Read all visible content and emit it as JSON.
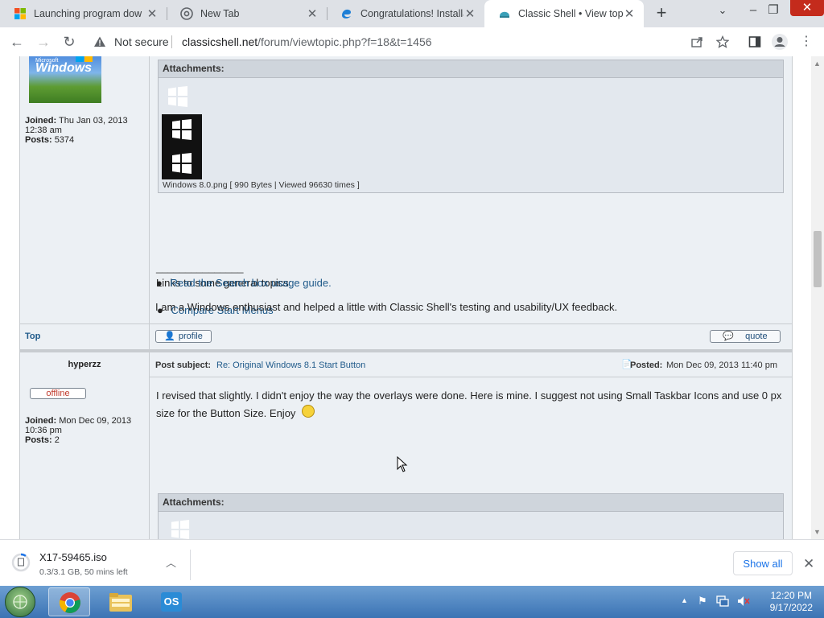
{
  "browser": {
    "tabs": [
      {
        "title": "Launching program dow",
        "active": false
      },
      {
        "title": "New Tab",
        "active": false
      },
      {
        "title": "Congratulations! Installat",
        "active": false
      },
      {
        "title": "Classic Shell • View topic",
        "active": true
      }
    ],
    "security_label": "Not secure",
    "url_host": "classicshell.net",
    "url_path": "/forum/viewtopic.php?f=18&t=1456"
  },
  "post1": {
    "avatar_text": "Windows",
    "avatar_subtext": "Microsoft",
    "joined_label": "Joined:",
    "joined_value": "Thu Jan 03, 2013 12:38 am",
    "posts_label": "Posts:",
    "posts_value": "5374",
    "attachments_label": "Attachments:",
    "attachment_file": "Windows 8.0.png [ 990 Bytes | Viewed 96630 times ]",
    "signature_rule": "_______________",
    "links_intro": "Links to some general topics:",
    "link_1": "Compare Start Menus",
    "link_2": "Read the Search box usage guide.",
    "sig_text": "I am a Windows enthusiast and helped a little with Classic Shell's testing and usability/UX feedback.",
    "top_link": "Top",
    "profile_btn": "profile",
    "quote_btn": "quote"
  },
  "post2": {
    "author": "hyperzz",
    "status": "offline",
    "joined_label": "Joined:",
    "joined_value": "Mon Dec 09, 2013 10:36 pm",
    "posts_label": "Posts:",
    "posts_value": "2",
    "subject_label": "Post subject:",
    "subject": "Re: Original Windows 8.1 Start Button",
    "posted_label": "Posted:",
    "posted_value": "Mon Dec 09, 2013 11:40 pm",
    "body": "I revised that slightly. I didn't enjoy the way the overlays were done. Here is mine. I suggest not using Small Taskbar Icons and use 0 px size for the Button Size. Enjoy",
    "attachments_label": "Attachments:"
  },
  "download": {
    "filename": "X17-59465.iso",
    "status": "0.3/3.1 GB, 50 mins left",
    "show_all": "Show all"
  },
  "taskbar": {
    "time": "12:20 PM",
    "date": "9/17/2022",
    "app_label": "OS"
  },
  "colors": {
    "forum_bg": "#ecf0f4",
    "link": "#1f5a8a",
    "chrome_accent": "#1a73e8",
    "offline_badge": "#c0392b"
  }
}
